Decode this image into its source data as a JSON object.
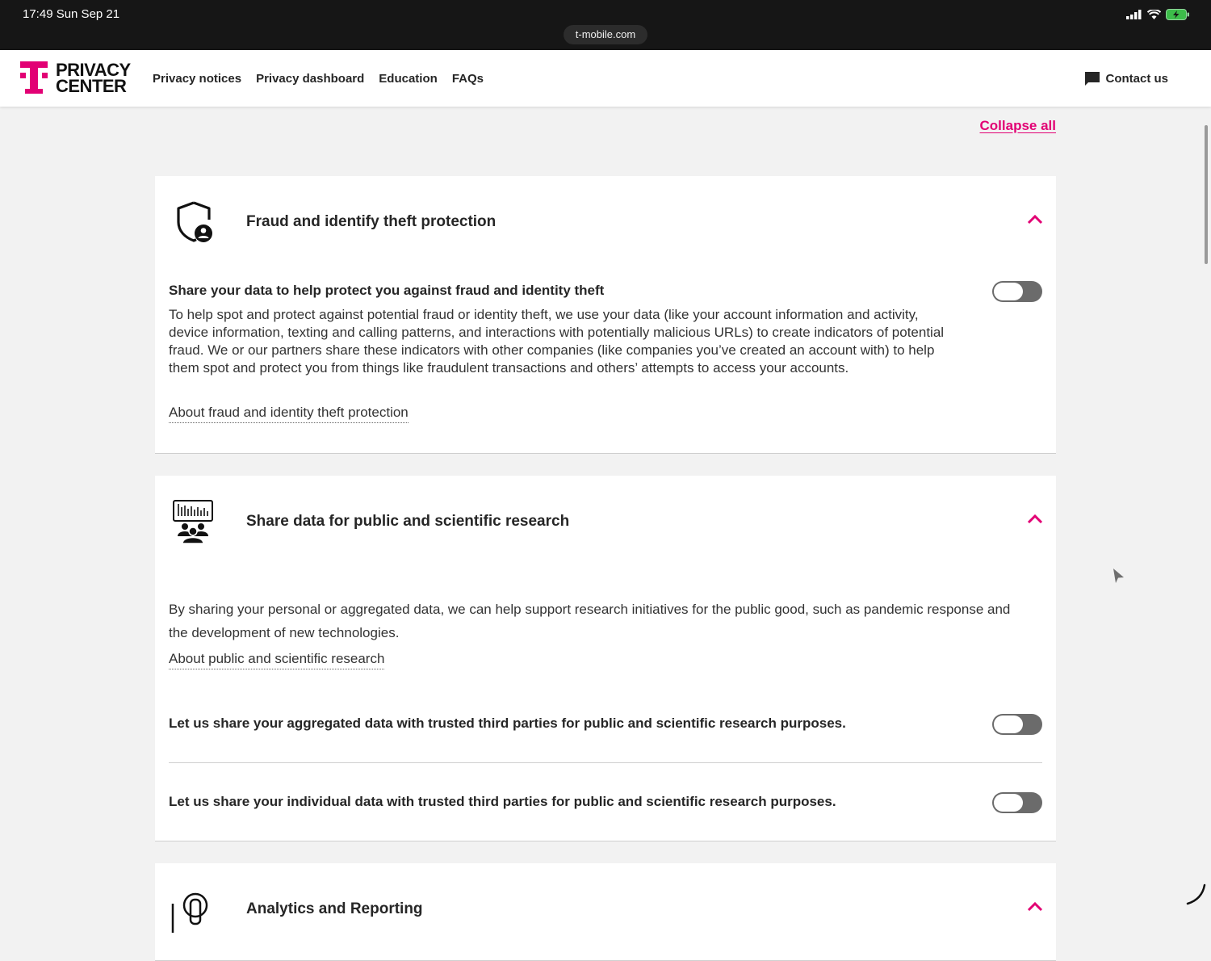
{
  "status_bar": {
    "time": "17:49  Sun Sep 21",
    "url": "t-mobile.com"
  },
  "header": {
    "logo_line1": "PRIVACY",
    "logo_line2": "CENTER",
    "nav": [
      "Privacy notices",
      "Privacy dashboard",
      "Education",
      "FAQs"
    ],
    "contact": "Contact us"
  },
  "collapse_all": "Collapse all",
  "colors": {
    "brand": "#e20074",
    "toggle_off": "#6b6b6b"
  },
  "sections": [
    {
      "icon": "shield-user-icon",
      "title": "Fraud and identify theft protection",
      "option_title": "Share your data to help protect you against fraud and identity theft",
      "option_on": false,
      "description": "To help spot and protect against potential fraud or identity theft, we use your data (like your account information and activity, device information, texting and calling patterns, and interactions with potentially malicious URLs) to create indicators of potential fraud. We or our partners share these indicators with other companies (like companies you’ve created an account with) to help them spot and protect you from things like fraudulent transactions and others’ attempts to access your accounts.",
      "link": "About fraud and identity theft protection"
    },
    {
      "icon": "research-group-icon",
      "title": "Share data for public and scientific research",
      "description": "By sharing your personal or aggregated data, we can help support research initiatives for the public good, such as pandemic response and the development of new technologies.",
      "link": "About public and scientific research",
      "options": [
        {
          "label": "Let us share your aggregated data with trusted third parties for public and scientific research purposes.",
          "on": false
        },
        {
          "label": "Let us share your individual data with trusted third parties for public and scientific research purposes.",
          "on": false
        }
      ]
    },
    {
      "icon": "analytics-icon",
      "title": "Analytics and Reporting"
    }
  ]
}
